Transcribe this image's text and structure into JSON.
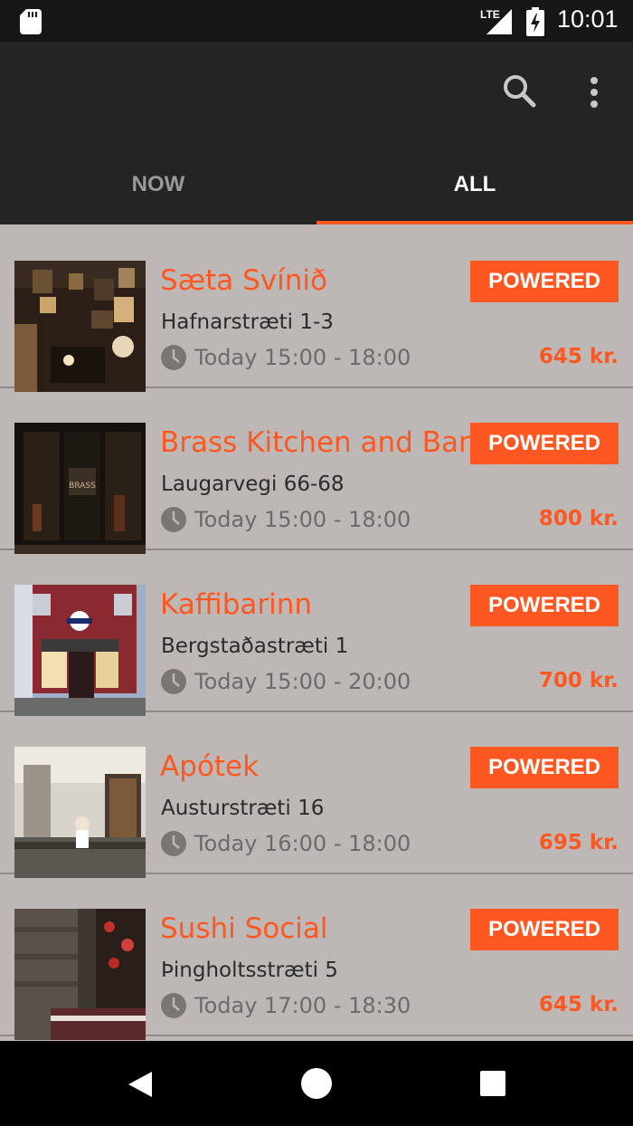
{
  "status_bar": {
    "network": "LTE",
    "time": "10:01"
  },
  "tabs": [
    {
      "label": "NOW",
      "active": false
    },
    {
      "label": "ALL",
      "active": true
    }
  ],
  "accent_color": "#ff5722",
  "icons": {
    "search": "search-icon",
    "more": "more-vert-icon",
    "clock": "clock-icon",
    "sd_card": "sd-card-icon",
    "signal": "signal-icon",
    "battery": "battery-charging-icon",
    "back": "back-icon",
    "home": "home-icon",
    "recents": "recents-icon"
  },
  "listings": [
    {
      "name": "Sæta Svínið",
      "address": "Hafnarstræti 1-3",
      "time": "Today 15:00 - 18:00",
      "badge": "POWERED",
      "price": "645 kr."
    },
    {
      "name": "Brass Kitchen and Bar",
      "address": "Laugarvegi 66-68",
      "time": "Today 15:00 - 18:00",
      "badge": "POWERED",
      "price": "800 kr."
    },
    {
      "name": "Kaffibarinn",
      "address": "Bergstaðastræti 1",
      "time": "Today 15:00 - 20:00",
      "badge": "POWERED",
      "price": "700 kr."
    },
    {
      "name": "Apótek",
      "address": "Austurstræti 16",
      "time": "Today 16:00 - 18:00",
      "badge": "POWERED",
      "price": "695 kr."
    },
    {
      "name": "Sushi Social",
      "address": "Þingholtsstræti 5",
      "time": "Today 17:00 - 18:30",
      "badge": "POWERED",
      "price": "645 kr."
    }
  ]
}
